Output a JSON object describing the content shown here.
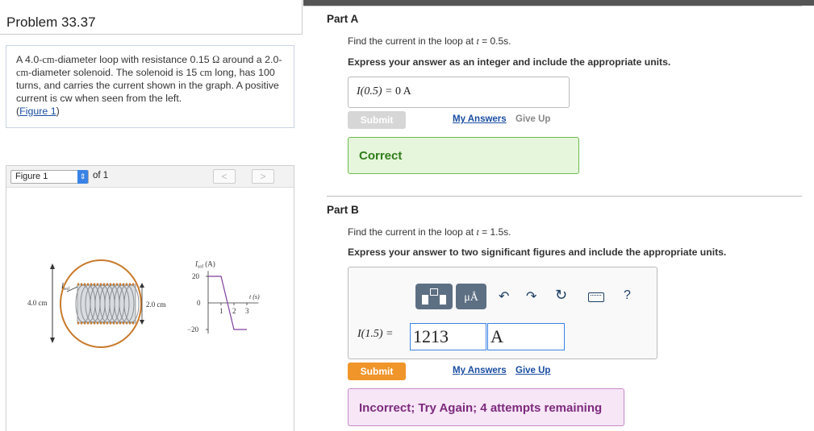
{
  "problem": {
    "title": "Problem 33.37",
    "text_before": "A 4.0-",
    "text_cm1": "cm",
    "text_mid1": "-diameter loop with resistance 0.15 ",
    "omega": "Ω",
    "text_mid2": " around a 2.0-",
    "text_cm2": "cm",
    "text_mid3": "-diameter solenoid. The solenoid is 15 ",
    "text_cm3": "cm",
    "text_mid4": " long, has 100 turns, and carries the current shown in the graph. A positive current is cw when seen from the left.",
    "figure_link_open": "(",
    "figure_link": "Figure 1",
    "figure_link_close": ")"
  },
  "figure": {
    "select_value": "Figure 1",
    "of_label": "of 1",
    "prev_icon": "chevron-left-icon",
    "next_icon": "chevron-right-icon",
    "labels": {
      "loop_diameter": "4.0 cm",
      "sol_diameter": "2.0 cm",
      "isol": "I",
      "isol_sub": "sol",
      "graph_y_label": "I",
      "graph_y_sub": "sol",
      "graph_y_unit": " (A)",
      "y_20": "20",
      "y_0": "0",
      "y_m20": "−20",
      "x_1": "1",
      "x_2": "2",
      "x_3": "3",
      "x_label": "t (s)"
    },
    "graph_data": {
      "type": "line",
      "x": [
        0,
        1,
        2,
        3
      ],
      "y": [
        20,
        20,
        -20,
        -20
      ],
      "ylim": [
        -20,
        20
      ],
      "xlim": [
        0,
        3
      ]
    }
  },
  "partA": {
    "title": "Part A",
    "question_pre": "Find the current in the loop at ",
    "t_var": "t",
    "question_post": " = 0.5s.",
    "instruction": "Express your answer as an integer and include the appropriate units.",
    "answer_label": "I(0.5) = ",
    "answer_value": "0 A",
    "submit": "Submit",
    "my_answers": "My Answers",
    "give_up": "Give Up",
    "feedback": "Correct"
  },
  "partB": {
    "title": "Part B",
    "question_pre": "Find the current in the loop at ",
    "t_var": "t",
    "question_post": " = 1.5s.",
    "instruction": "Express your answer to two significant figures and include the appropriate units.",
    "answer_label": "I(1.5) = ",
    "value": "1213",
    "units": "A",
    "toolbar_units_label": "μÅ",
    "help_label": "?",
    "submit": "Submit",
    "my_answers": "My Answers",
    "give_up": "Give Up",
    "feedback": "Incorrect; Try Again; 4 attempts remaining"
  },
  "colors": {
    "correct_bg": "#e6f6dc",
    "correct_border": "#6bbb4e",
    "correct_text": "#2f7d1a",
    "incorrect_bg": "#f6e6f6",
    "incorrect_border": "#c58ac5",
    "incorrect_text": "#7d2a7d",
    "submit_orange": "#f0952a",
    "submit_disabled": "#d6d6d6",
    "link_blue": "#1a4da1",
    "graph_purple": "#7f3f9f"
  }
}
